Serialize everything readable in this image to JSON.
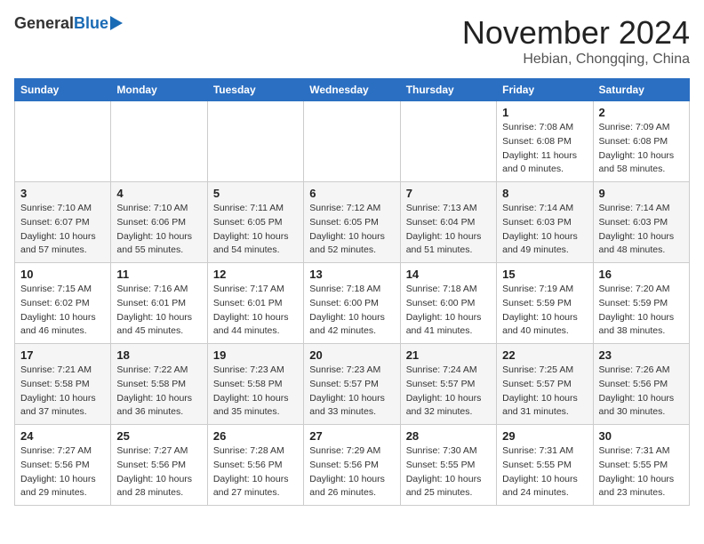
{
  "header": {
    "logo_general": "General",
    "logo_blue": "Blue",
    "month": "November 2024",
    "location": "Hebian, Chongqing, China"
  },
  "weekdays": [
    "Sunday",
    "Monday",
    "Tuesday",
    "Wednesday",
    "Thursday",
    "Friday",
    "Saturday"
  ],
  "weeks": [
    [
      {
        "day": "",
        "info": ""
      },
      {
        "day": "",
        "info": ""
      },
      {
        "day": "",
        "info": ""
      },
      {
        "day": "",
        "info": ""
      },
      {
        "day": "",
        "info": ""
      },
      {
        "day": "1",
        "info": "Sunrise: 7:08 AM\nSunset: 6:08 PM\nDaylight: 11 hours\nand 0 minutes."
      },
      {
        "day": "2",
        "info": "Sunrise: 7:09 AM\nSunset: 6:08 PM\nDaylight: 10 hours\nand 58 minutes."
      }
    ],
    [
      {
        "day": "3",
        "info": "Sunrise: 7:10 AM\nSunset: 6:07 PM\nDaylight: 10 hours\nand 57 minutes."
      },
      {
        "day": "4",
        "info": "Sunrise: 7:10 AM\nSunset: 6:06 PM\nDaylight: 10 hours\nand 55 minutes."
      },
      {
        "day": "5",
        "info": "Sunrise: 7:11 AM\nSunset: 6:05 PM\nDaylight: 10 hours\nand 54 minutes."
      },
      {
        "day": "6",
        "info": "Sunrise: 7:12 AM\nSunset: 6:05 PM\nDaylight: 10 hours\nand 52 minutes."
      },
      {
        "day": "7",
        "info": "Sunrise: 7:13 AM\nSunset: 6:04 PM\nDaylight: 10 hours\nand 51 minutes."
      },
      {
        "day": "8",
        "info": "Sunrise: 7:14 AM\nSunset: 6:03 PM\nDaylight: 10 hours\nand 49 minutes."
      },
      {
        "day": "9",
        "info": "Sunrise: 7:14 AM\nSunset: 6:03 PM\nDaylight: 10 hours\nand 48 minutes."
      }
    ],
    [
      {
        "day": "10",
        "info": "Sunrise: 7:15 AM\nSunset: 6:02 PM\nDaylight: 10 hours\nand 46 minutes."
      },
      {
        "day": "11",
        "info": "Sunrise: 7:16 AM\nSunset: 6:01 PM\nDaylight: 10 hours\nand 45 minutes."
      },
      {
        "day": "12",
        "info": "Sunrise: 7:17 AM\nSunset: 6:01 PM\nDaylight: 10 hours\nand 44 minutes."
      },
      {
        "day": "13",
        "info": "Sunrise: 7:18 AM\nSunset: 6:00 PM\nDaylight: 10 hours\nand 42 minutes."
      },
      {
        "day": "14",
        "info": "Sunrise: 7:18 AM\nSunset: 6:00 PM\nDaylight: 10 hours\nand 41 minutes."
      },
      {
        "day": "15",
        "info": "Sunrise: 7:19 AM\nSunset: 5:59 PM\nDaylight: 10 hours\nand 40 minutes."
      },
      {
        "day": "16",
        "info": "Sunrise: 7:20 AM\nSunset: 5:59 PM\nDaylight: 10 hours\nand 38 minutes."
      }
    ],
    [
      {
        "day": "17",
        "info": "Sunrise: 7:21 AM\nSunset: 5:58 PM\nDaylight: 10 hours\nand 37 minutes."
      },
      {
        "day": "18",
        "info": "Sunrise: 7:22 AM\nSunset: 5:58 PM\nDaylight: 10 hours\nand 36 minutes."
      },
      {
        "day": "19",
        "info": "Sunrise: 7:23 AM\nSunset: 5:58 PM\nDaylight: 10 hours\nand 35 minutes."
      },
      {
        "day": "20",
        "info": "Sunrise: 7:23 AM\nSunset: 5:57 PM\nDaylight: 10 hours\nand 33 minutes."
      },
      {
        "day": "21",
        "info": "Sunrise: 7:24 AM\nSunset: 5:57 PM\nDaylight: 10 hours\nand 32 minutes."
      },
      {
        "day": "22",
        "info": "Sunrise: 7:25 AM\nSunset: 5:57 PM\nDaylight: 10 hours\nand 31 minutes."
      },
      {
        "day": "23",
        "info": "Sunrise: 7:26 AM\nSunset: 5:56 PM\nDaylight: 10 hours\nand 30 minutes."
      }
    ],
    [
      {
        "day": "24",
        "info": "Sunrise: 7:27 AM\nSunset: 5:56 PM\nDaylight: 10 hours\nand 29 minutes."
      },
      {
        "day": "25",
        "info": "Sunrise: 7:27 AM\nSunset: 5:56 PM\nDaylight: 10 hours\nand 28 minutes."
      },
      {
        "day": "26",
        "info": "Sunrise: 7:28 AM\nSunset: 5:56 PM\nDaylight: 10 hours\nand 27 minutes."
      },
      {
        "day": "27",
        "info": "Sunrise: 7:29 AM\nSunset: 5:56 PM\nDaylight: 10 hours\nand 26 minutes."
      },
      {
        "day": "28",
        "info": "Sunrise: 7:30 AM\nSunset: 5:55 PM\nDaylight: 10 hours\nand 25 minutes."
      },
      {
        "day": "29",
        "info": "Sunrise: 7:31 AM\nSunset: 5:55 PM\nDaylight: 10 hours\nand 24 minutes."
      },
      {
        "day": "30",
        "info": "Sunrise: 7:31 AM\nSunset: 5:55 PM\nDaylight: 10 hours\nand 23 minutes."
      }
    ]
  ]
}
